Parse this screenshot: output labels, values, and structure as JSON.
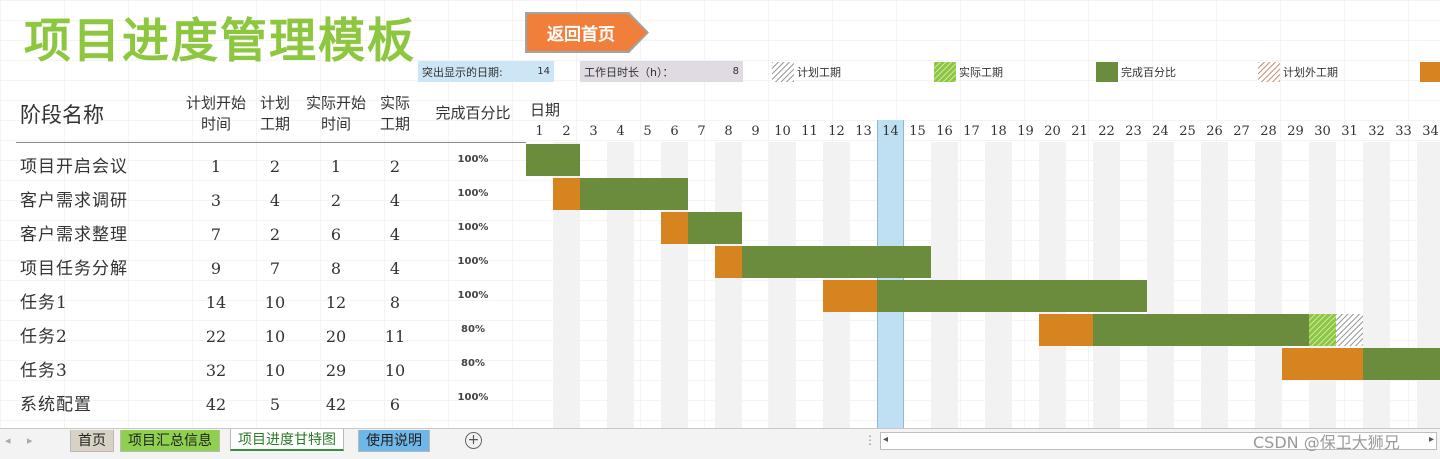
{
  "title": "项目进度管理模板",
  "home_button": "返回首页",
  "params": {
    "highlight_label": "突出显示的日期:",
    "highlight_value": "14",
    "hours_label": "工作日时长（h）：",
    "hours_value": "8"
  },
  "legend": [
    {
      "label": "计划工期",
      "pattern": "plan-hatch"
    },
    {
      "label": "实际工期",
      "pattern": "actual-hatch"
    },
    {
      "label": "完成百分比",
      "pattern": "done-solid"
    },
    {
      "label": "计划外工期",
      "pattern": "outside-hatch"
    }
  ],
  "headers": {
    "stage": "阶段名称",
    "plan_start_1": "计划开始",
    "plan_start_2": "时间",
    "plan_days_1": "计划",
    "plan_days_2": "工期",
    "actual_start_1": "实际开始",
    "actual_start_2": "时间",
    "actual_days_1": "实际",
    "actual_days_2": "工期",
    "percent": "完成百分比",
    "date": "日期"
  },
  "day_numbers": [
    "1",
    "2",
    "3",
    "4",
    "5",
    "6",
    "7",
    "8",
    "9",
    "10",
    "11",
    "12",
    "13",
    "14",
    "15",
    "16",
    "17",
    "18",
    "19",
    "20",
    "21",
    "22",
    "23",
    "24",
    "25",
    "26",
    "27",
    "28",
    "29",
    "30",
    "31",
    "32",
    "33",
    "34"
  ],
  "highlight_day": 14,
  "rows": [
    {
      "name": "项目开启会议",
      "plan_start": "1",
      "plan_days": "2",
      "actual_start": "1",
      "actual_days": "2",
      "percent": "100%"
    },
    {
      "name": "客户需求调研",
      "plan_start": "3",
      "plan_days": "4",
      "actual_start": "2",
      "actual_days": "4",
      "percent": "100%"
    },
    {
      "name": "客户需求整理",
      "plan_start": "7",
      "plan_days": "2",
      "actual_start": "6",
      "actual_days": "4",
      "percent": "100%"
    },
    {
      "name": "项目任务分解",
      "plan_start": "9",
      "plan_days": "7",
      "actual_start": "8",
      "actual_days": "4",
      "percent": "100%"
    },
    {
      "name": "任务1",
      "plan_start": "14",
      "plan_days": "10",
      "actual_start": "12",
      "actual_days": "8",
      "percent": "100%"
    },
    {
      "name": "任务2",
      "plan_start": "22",
      "plan_days": "10",
      "actual_start": "20",
      "actual_days": "11",
      "percent": "80%"
    },
    {
      "name": "任务3",
      "plan_start": "32",
      "plan_days": "10",
      "actual_start": "29",
      "actual_days": "10",
      "percent": "80%"
    },
    {
      "name": "系统配置",
      "plan_start": "42",
      "plan_days": "5",
      "actual_start": "42",
      "actual_days": "6",
      "percent": "100%"
    }
  ],
  "colors": {
    "title": "#8dc63f",
    "done": "#6a8c3c",
    "actual": "#8dc63f",
    "outside": "#d5841f",
    "highlight": "#bfe0f2",
    "home_button": "#ef7f3a"
  },
  "sheet_tabs": [
    {
      "label": "首页",
      "color": "#d8d2c4",
      "active": false
    },
    {
      "label": "项目汇总信息",
      "color": "#8fd14f",
      "active": false
    },
    {
      "label": "项目进度甘特图",
      "color": "#ffffff",
      "active": true
    },
    {
      "label": "使用说明",
      "color": "#6fb7e8",
      "active": false
    }
  ],
  "watermark": "CSDN @保卫大狮兄"
}
